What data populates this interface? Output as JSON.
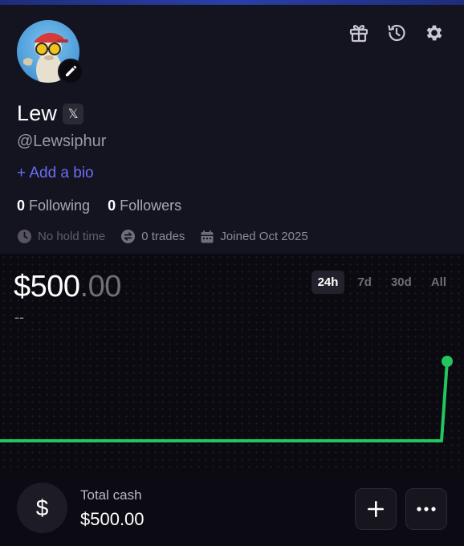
{
  "profile": {
    "name": "Lew",
    "x_badge": "𝕏",
    "handle": "@Lewsiphur",
    "add_bio": "+ Add a bio",
    "following_count": "0",
    "following_label": "Following",
    "followers_count": "0",
    "followers_label": "Followers",
    "hold_time": "No hold time",
    "trades": "0 trades",
    "joined": "Joined Oct 2025"
  },
  "toolbar": {
    "icons": [
      "gift-icon",
      "history-icon",
      "settings-icon"
    ]
  },
  "portfolio": {
    "balance_whole": "$500",
    "balance_cents": ".00",
    "change": "--",
    "ranges": [
      "24h",
      "7d",
      "30d",
      "All"
    ],
    "active_range": "24h",
    "accent": "#22c55e"
  },
  "chart_data": {
    "type": "line",
    "title": "",
    "xlabel": "",
    "ylabel": "",
    "series": [
      {
        "values": [
          500,
          500,
          500,
          500,
          500,
          500,
          500,
          500,
          500,
          500,
          500,
          500,
          500
        ]
      }
    ]
  },
  "cash": {
    "symbol": "$",
    "label": "Total cash",
    "value": "$500.00"
  },
  "actions": {
    "add": "+",
    "more": "•••"
  }
}
